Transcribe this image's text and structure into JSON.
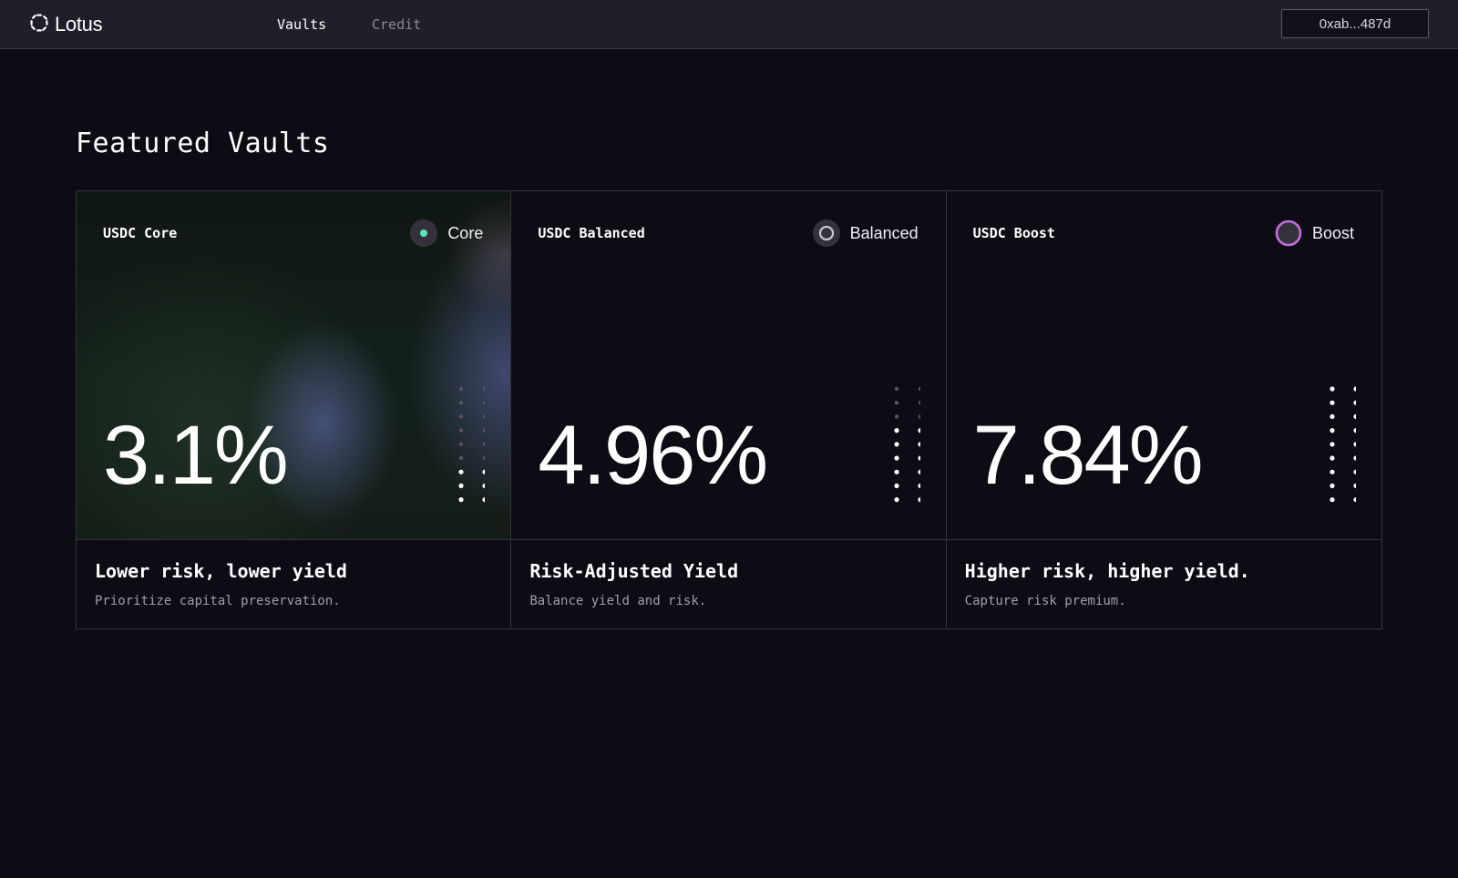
{
  "header": {
    "logo_text": "Lotus",
    "nav": [
      {
        "label": "Vaults",
        "active": true
      },
      {
        "label": "Credit",
        "active": false
      }
    ],
    "wallet_address": "0xab...487d"
  },
  "main": {
    "title": "Featured Vaults",
    "vaults": [
      {
        "name": "USDC Core",
        "tier": "Core",
        "tier_icon": "filled-dot-icon",
        "accent": "#5fe3b0",
        "apy": "3.1%",
        "headline": "Lower risk, lower yield",
        "description": "Prioritize capital preservation.",
        "risk_level": 1
      },
      {
        "name": "USDC Balanced",
        "tier": "Balanced",
        "tier_icon": "ring-icon",
        "accent": "#c9c7ce",
        "apy": "4.96%",
        "headline": "Risk-Adjusted Yield",
        "description": "Balance yield and risk.",
        "risk_level": 2
      },
      {
        "name": "USDC Boost",
        "tier": "Boost",
        "tier_icon": "ring-icon",
        "accent": "#c46ee0",
        "apy": "7.84%",
        "headline": "Higher risk, higher yield.",
        "description": "Capture risk premium.",
        "risk_level": 3
      }
    ]
  }
}
